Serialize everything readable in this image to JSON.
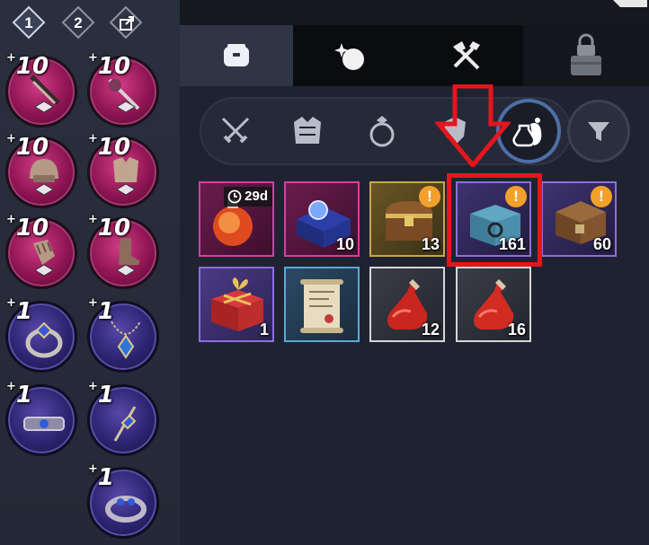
{
  "presets": [
    {
      "label": "1",
      "active": true
    },
    {
      "label": "2",
      "active": false
    }
  ],
  "share_icon": "share-export-icon",
  "equipment": [
    {
      "name": "weapon-slot",
      "plus": "+",
      "level": "10",
      "tier": "pink"
    },
    {
      "name": "weapon-offhand-slot",
      "plus": "+",
      "level": "10",
      "tier": "pink"
    },
    {
      "name": "helmet-slot",
      "plus": "+",
      "level": "10",
      "tier": "pink"
    },
    {
      "name": "armor-slot",
      "plus": "+",
      "level": "10",
      "tier": "pink"
    },
    {
      "name": "gloves-slot",
      "plus": "+",
      "level": "10",
      "tier": "pink"
    },
    {
      "name": "boots-slot",
      "plus": "+",
      "level": "10",
      "tier": "pink"
    },
    {
      "name": "ring-left-slot",
      "plus": "+",
      "level": "1",
      "tier": "blue"
    },
    {
      "name": "necklace-slot",
      "plus": "+",
      "level": "1",
      "tier": "blue"
    },
    {
      "name": "bracelet-slot",
      "plus": "+",
      "level": "1",
      "tier": "blue"
    },
    {
      "name": "earring-slot",
      "plus": "+",
      "level": "1",
      "tier": "blue"
    },
    {
      "name": "ring-right-slot",
      "plus": "+",
      "level": "1",
      "tier": "blue"
    }
  ],
  "tabs": [
    {
      "icon": "bag-icon",
      "active": true
    },
    {
      "icon": "bomb-icon",
      "active": false
    },
    {
      "icon": "crafting-tools-icon",
      "active": false
    },
    {
      "icon": "locked-storage-icon",
      "active": false
    }
  ],
  "categories": [
    {
      "icon": "crossed-swords-icon",
      "active": false
    },
    {
      "icon": "armor-icon",
      "active": false
    },
    {
      "icon": "ring-icon",
      "active": false
    },
    {
      "icon": "shield-icon",
      "active": false
    },
    {
      "icon": "potion-bag-icon",
      "active": true
    }
  ],
  "filter_icon": "filter-funnel-icon",
  "inventory": [
    {
      "name": "elixir-item",
      "rarity": "pink",
      "timer": "29d",
      "qty": "",
      "alert": false
    },
    {
      "name": "jewel-box-item",
      "rarity": "pink",
      "timer": "",
      "qty": "10",
      "alert": false
    },
    {
      "name": "gold-chest-item",
      "rarity": "gold",
      "timer": "",
      "qty": "13",
      "alert": true
    },
    {
      "name": "steel-chest-item",
      "rarity": "violet",
      "timer": "",
      "qty": "161",
      "alert": true
    },
    {
      "name": "wooden-chest-item",
      "rarity": "violet",
      "timer": "",
      "qty": "60",
      "alert": true
    },
    {
      "name": "gift-box-item",
      "rarity": "blueP",
      "timer": "",
      "qty": "1",
      "alert": false
    },
    {
      "name": "scroll-item",
      "rarity": "cyan",
      "timer": "",
      "qty": "",
      "alert": false
    },
    {
      "name": "hp-potion-item",
      "rarity": "white",
      "timer": "",
      "qty": "12",
      "alert": false
    },
    {
      "name": "hp-potion-large-item",
      "rarity": "white",
      "timer": "",
      "qty": "16",
      "alert": false
    }
  ],
  "alert_mark": "!",
  "highlight_color": "#e5151c"
}
